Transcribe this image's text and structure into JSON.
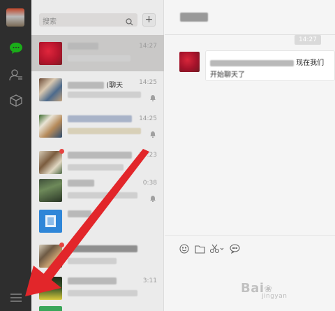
{
  "search": {
    "placeholder": "搜索"
  },
  "add_label": "+",
  "conversations": [
    {
      "name_visible": "",
      "time": "14:27",
      "selected": true
    },
    {
      "name_visible": "(聊天",
      "time": "14:25",
      "selected": false
    },
    {
      "name_visible": "",
      "time": "14:25",
      "selected": false
    },
    {
      "name_visible": "",
      "time": "14:23",
      "selected": false
    },
    {
      "name_visible": "",
      "time": "0:38",
      "selected": false
    },
    {
      "name_visible": "",
      "time": "",
      "selected": false
    },
    {
      "name_visible": "",
      "time": "",
      "selected": false
    },
    {
      "name_visible": "",
      "time": "3:11",
      "selected": false
    }
  ],
  "chat": {
    "time_stamp": "14:27",
    "message_line1": "现在我们",
    "message_line2": "开始聊天了"
  },
  "watermark": {
    "brand": "Bai",
    "sub": "jingyan"
  },
  "colors": {
    "rail": "#2e2e2e",
    "chat_icon_green": "#1aad19",
    "arrow_red": "#e2262a"
  }
}
